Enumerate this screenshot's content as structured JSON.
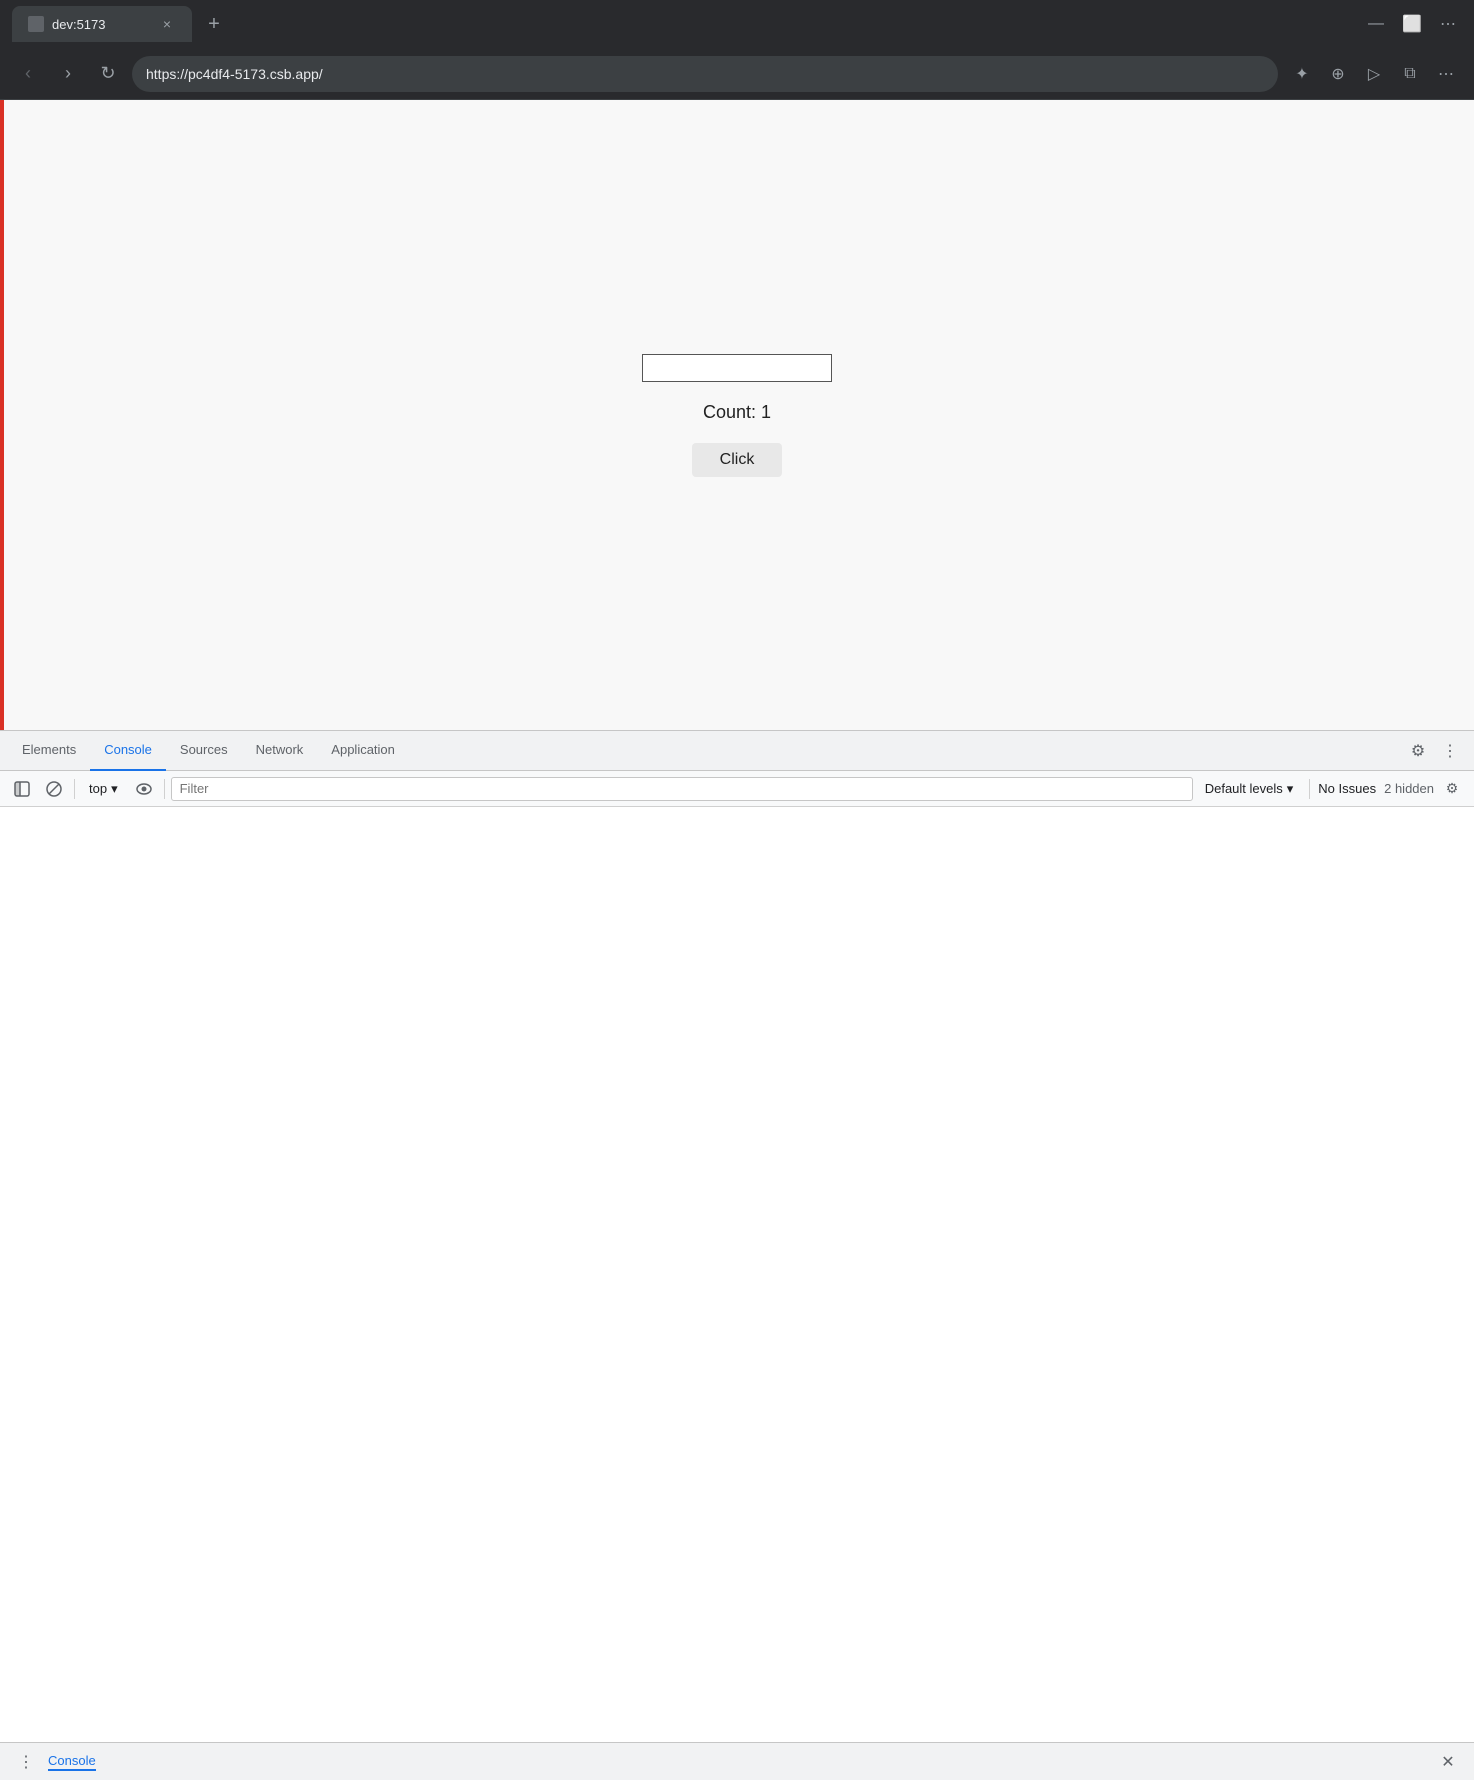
{
  "browser": {
    "tab": {
      "title": "dev:5173",
      "close_label": "×"
    },
    "new_tab_label": "+",
    "controls": {
      "minimize": "—",
      "maximize": "⬜",
      "more": "⋯"
    },
    "nav": {
      "back_label": "‹",
      "forward_label": "›",
      "reload_label": "↻",
      "url": "https://pc4df4-5173.csb.app/",
      "pin_label": "✦",
      "location_label": "⊕",
      "cast_label": "▷",
      "split_label": "⧉",
      "more_label": "⋯"
    }
  },
  "app": {
    "input_placeholder": "",
    "count_label": "Count: 1",
    "click_button_label": "Click"
  },
  "devtools": {
    "tabs": [
      {
        "id": "elements",
        "label": "Elements"
      },
      {
        "id": "console",
        "label": "Console"
      },
      {
        "id": "sources",
        "label": "Sources"
      },
      {
        "id": "network",
        "label": "Network"
      },
      {
        "id": "application",
        "label": "Application"
      }
    ],
    "active_tab": "console",
    "settings_icon": "⚙",
    "more_icon": "⋮",
    "console_toolbar": {
      "sidebar_icon": "⊞",
      "clear_icon": "⊘",
      "context": "top",
      "context_arrow": "▾",
      "eye_icon": "👁",
      "filter_placeholder": "Filter",
      "default_levels_label": "Default levels",
      "dropdown_arrow": "▾",
      "no_issues_label": "No Issues",
      "hidden_count_label": "2 hidden",
      "settings_icon": "⚙"
    },
    "bottom_bar": {
      "more_icon": "⋮",
      "label": "Console",
      "close_icon": "✕"
    }
  }
}
